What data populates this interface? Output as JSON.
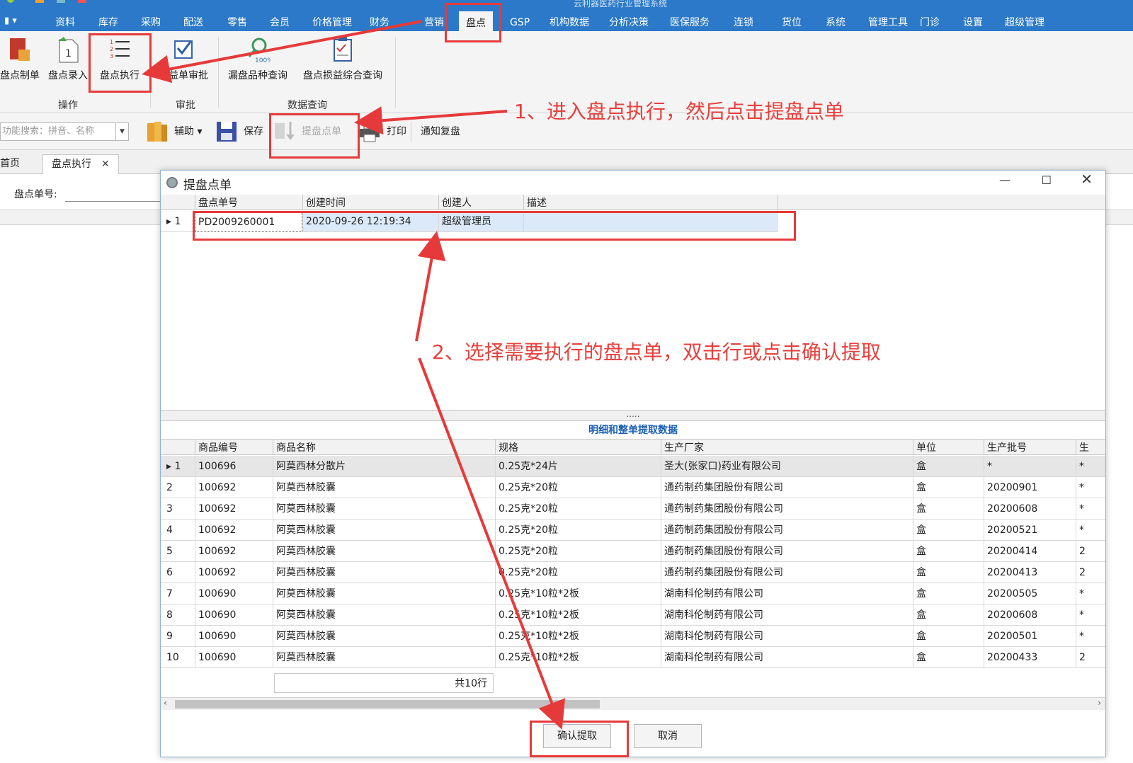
{
  "menubar": {
    "app_button": "▮ ▾",
    "window_title": "云利器医药行业管理系统",
    "tabs": [
      "资料",
      "库存",
      "采购",
      "配送",
      "零售",
      "会员",
      "价格管理",
      "财务",
      "营销",
      "盘点",
      "GSP",
      "机构数据",
      "分析决策",
      "医保服务",
      "连锁",
      "货位",
      "系统",
      "管理工具",
      "门诊",
      "设置",
      "超级管理"
    ],
    "active_tab": "盘点"
  },
  "ribbon": {
    "buttons": [
      "盘点制单",
      "盘点录入",
      "盘点执行",
      "损益单审批",
      "漏盘品种查询",
      "盘点损益综合查询"
    ],
    "groups": [
      "操作",
      "审批",
      "数据查询"
    ]
  },
  "toolbar2": {
    "search_placeholder": "功能搜索：拼音、名称",
    "assist": "辅助",
    "save": "保存",
    "fetch": "提盘点单",
    "print": "打印",
    "notify": "通知复盘"
  },
  "doctabs": {
    "home": "首页",
    "current": "盘点执行",
    "close": "✕"
  },
  "background": {
    "field_label": "盘点单号:"
  },
  "dialog": {
    "title": "提盘点单",
    "top_grid": {
      "columns": [
        "盘点单号",
        "创建时间",
        "创建人",
        "描述"
      ],
      "rows": [
        {
          "n": "1",
          "no": "PD2009260001",
          "time": "2020-09-26 12:19:34",
          "creator": "超级管理员",
          "desc": ""
        }
      ]
    },
    "splitter": ".....",
    "detail_caption": "明细和整单提取数据",
    "detail_grid": {
      "columns": [
        "商品编号",
        "商品名称",
        "规格",
        "生产厂家",
        "单位",
        "生产批号",
        "生"
      ],
      "rows": [
        {
          "n": "1",
          "code": "100696",
          "name": "阿莫西林分散片",
          "spec": "0.25克*24片",
          "maker": "圣大(张家口)药业有限公司",
          "unit": "盒",
          "batch": "*",
          "tail": "*"
        },
        {
          "n": "2",
          "code": "100692",
          "name": "阿莫西林胶囊",
          "spec": "0.25克*20粒",
          "maker": "通药制药集团股份有限公司",
          "unit": "盒",
          "batch": "20200901",
          "tail": "*"
        },
        {
          "n": "3",
          "code": "100692",
          "name": "阿莫西林胶囊",
          "spec": "0.25克*20粒",
          "maker": "通药制药集团股份有限公司",
          "unit": "盒",
          "batch": "20200608",
          "tail": "*"
        },
        {
          "n": "4",
          "code": "100692",
          "name": "阿莫西林胶囊",
          "spec": "0.25克*20粒",
          "maker": "通药制药集团股份有限公司",
          "unit": "盒",
          "batch": "20200521",
          "tail": "*"
        },
        {
          "n": "5",
          "code": "100692",
          "name": "阿莫西林胶囊",
          "spec": "0.25克*20粒",
          "maker": "通药制药集团股份有限公司",
          "unit": "盒",
          "batch": "20200414",
          "tail": "2"
        },
        {
          "n": "6",
          "code": "100692",
          "name": "阿莫西林胶囊",
          "spec": "0.25克*20粒",
          "maker": "通药制药集团股份有限公司",
          "unit": "盒",
          "batch": "20200413",
          "tail": "2"
        },
        {
          "n": "7",
          "code": "100690",
          "name": "阿莫西林胶囊",
          "spec": "0.25克*10粒*2板",
          "maker": "湖南科伦制药有限公司",
          "unit": "盒",
          "batch": "20200505",
          "tail": "*"
        },
        {
          "n": "8",
          "code": "100690",
          "name": "阿莫西林胶囊",
          "spec": "0.25克*10粒*2板",
          "maker": "湖南科伦制药有限公司",
          "unit": "盒",
          "batch": "20200608",
          "tail": "*"
        },
        {
          "n": "9",
          "code": "100690",
          "name": "阿莫西林胶囊",
          "spec": "0.25克*10粒*2板",
          "maker": "湖南科伦制药有限公司",
          "unit": "盒",
          "batch": "20200501",
          "tail": "*"
        },
        {
          "n": "10",
          "code": "100690",
          "name": "阿莫西林胶囊",
          "spec": "0.25克*10粒*2板",
          "maker": "湖南科伦制药有限公司",
          "unit": "盒",
          "batch": "20200433",
          "tail": "2"
        }
      ]
    },
    "row_count": "共10行",
    "confirm": "确认提取",
    "cancel": "取消"
  },
  "annotations": {
    "step1": "1、进入盘点执行，然后点击提盘点单",
    "step2": "2、选择需要执行的盘点单，双击行或点击确认提取"
  },
  "colors": {
    "menubar": "#2b79c8",
    "annotation": "#e63a3a",
    "caption": "#1a5fb4"
  }
}
